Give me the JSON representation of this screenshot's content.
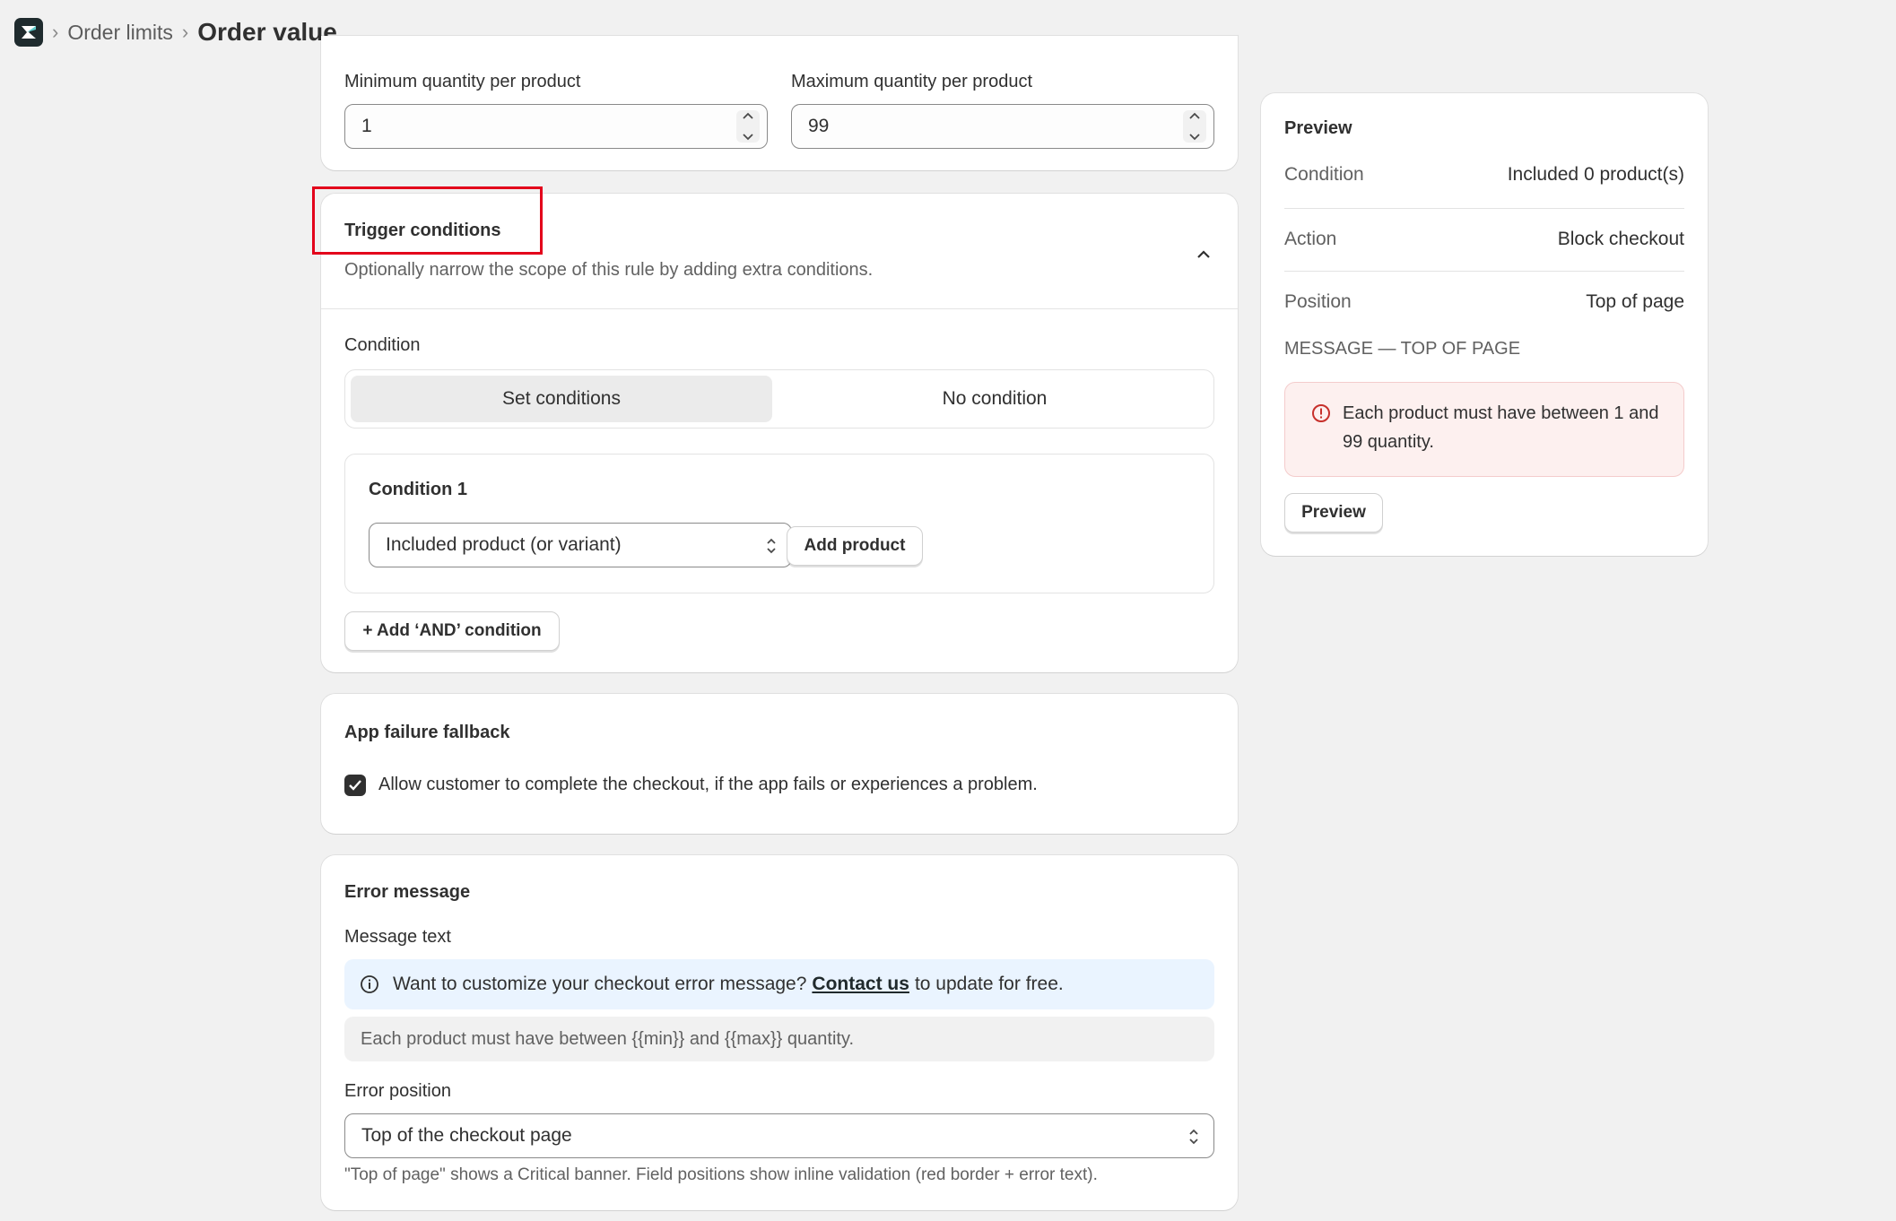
{
  "breadcrumb": {
    "parent": "Order limits",
    "current": "Order value"
  },
  "quantity": {
    "min_label": "Minimum quantity per product",
    "min_value": "1",
    "max_label": "Maximum quantity per product",
    "max_value": "99"
  },
  "trigger": {
    "title": "Trigger conditions",
    "description": "Optionally narrow the scope of this rule by adding extra conditions.",
    "condition_label": "Condition",
    "options": [
      "Set conditions",
      "No condition"
    ],
    "condition1_title": "Condition 1",
    "condition1_select": "Included product (or variant)",
    "add_product": "Add product",
    "add_and": "+ Add ‘AND’ condition"
  },
  "fallback": {
    "title": "App failure fallback",
    "checkbox_label": "Allow customer to complete the checkout, if the app fails or experiences a problem.",
    "checked": true
  },
  "error": {
    "title": "Error message",
    "message_label": "Message text",
    "info_before": "Want to customize your checkout error message?",
    "info_link": "Contact us",
    "info_after": "to update for free.",
    "message_value": "Each product must have between {{min}} and {{max}} quantity.",
    "position_label": "Error position",
    "position_value": "Top of the checkout page",
    "help_text": "\"Top of page\" shows a Critical banner. Field positions show inline validation (red border + error text)."
  },
  "preview": {
    "title": "Preview",
    "rows": [
      {
        "key": "Condition",
        "value": "Included 0 product(s)"
      },
      {
        "key": "Action",
        "value": "Block checkout"
      },
      {
        "key": "Position",
        "value": "Top of page"
      }
    ],
    "section_label": "MESSAGE — TOP OF PAGE",
    "banner_text": "Each product must have between 1 and 99 quantity.",
    "button": "Preview"
  },
  "colors": {
    "highlight": "#e3001b",
    "critical_bg": "#fdf0ef",
    "info_bg": "#eaf4ff"
  }
}
